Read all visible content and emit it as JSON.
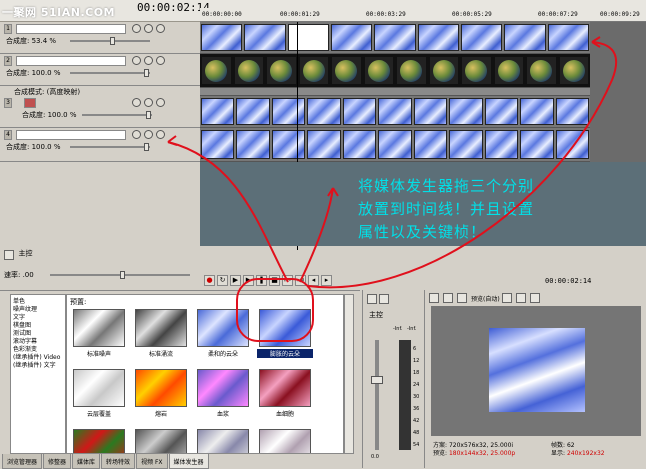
{
  "watermark": "一聚网 51IAN.COM",
  "timecode": "00:00:02:14",
  "ruler_ticks": [
    "00:00:00:00",
    "00:00:01:29",
    "00:00:03:29",
    "00:00:05:29",
    "00:00:07:29",
    "00:00:09:29"
  ],
  "tracks": [
    {
      "num": "1",
      "label": "合成度: 53.4 %",
      "type": "texture"
    },
    {
      "num": "2",
      "label": "合成度: 100.0 %",
      "type": "globe"
    },
    {
      "num": "3",
      "label": "合成度: 100.0 %",
      "type": "texture",
      "mode_label": "合成模式: (高度映射)"
    },
    {
      "num": "4",
      "label": "合成度: 100.0 %",
      "type": "texture"
    }
  ],
  "header_bottom": {
    "track_label": "主控",
    "rate_label": "速率: .00"
  },
  "transport_timecode": "00:00:02:14",
  "annotation": {
    "line1": "将媒体发生器拖三个分别",
    "line2": "放置到时间线！并且设置",
    "line3": "属性以及关键桢！"
  },
  "generators": [
    "单色",
    "噪声纹理",
    "文字",
    "棋盘图",
    "测试图",
    "滚动字幕",
    "色彩渐变",
    "(继承插件) Video",
    "(继承插件) 文字"
  ],
  "presets_title": "预置:",
  "presets": [
    {
      "label": "标准噪声",
      "colors": [
        "#777777",
        "#ffffff"
      ]
    },
    {
      "label": "标准涌流",
      "colors": [
        "#444444",
        "#e0e0e0"
      ]
    },
    {
      "label": "柔和的云朵",
      "colors": [
        "#4a6ad8",
        "#dde4ff"
      ]
    },
    {
      "label": "膨胀的云朵",
      "colors": [
        "#3a5ad8",
        "#c8d4ff"
      ],
      "selected": true
    },
    {
      "label": "云层覆盖",
      "colors": [
        "#c8c8c8",
        "#ffffff"
      ]
    },
    {
      "label": "熔岩",
      "colors": [
        "#ff4a00",
        "#ffd000"
      ]
    },
    {
      "label": "血浆",
      "colors": [
        "#6a5acd",
        "#ff88ff"
      ]
    },
    {
      "label": "血细胞",
      "colors": [
        "#8a1020",
        "#f4a0c0"
      ]
    },
    {
      "label": "",
      "colors": [
        "#2a7a20",
        "#d01818"
      ]
    },
    {
      "label": "",
      "colors": [
        "#555555",
        "#cccccc"
      ]
    },
    {
      "label": "",
      "colors": [
        "#8888aa",
        "#eeeeee"
      ]
    },
    {
      "label": "",
      "colors": [
        "#b0a0b0",
        "#ffffff"
      ]
    }
  ],
  "tabs": [
    "浏览管理器",
    "修整器",
    "媒体库",
    "转场特效",
    "视频 FX",
    "媒体发生器"
  ],
  "active_tab": 5,
  "mixer": {
    "label": "主控",
    "db_top": "-Inf.",
    "db_top2": "-Inf.",
    "scale": [
      "6",
      "12",
      "18",
      "24",
      "30",
      "36",
      "42",
      "48",
      "54"
    ],
    "bottom": "0.0"
  },
  "preview": {
    "mode": "预览(自动)",
    "project_label": "方案:",
    "project_value": "720x576x32, 25.000i",
    "preview_label": "预览:",
    "preview_value": "180x144x32, 25.000p",
    "frame_label": "帧数:",
    "frame_value": "62",
    "display_label": "显示:",
    "display_value": "240x192x32"
  },
  "colors": {
    "annotation": "#00e0e8",
    "circle": "#e0101c",
    "selection": "#0a246a"
  }
}
